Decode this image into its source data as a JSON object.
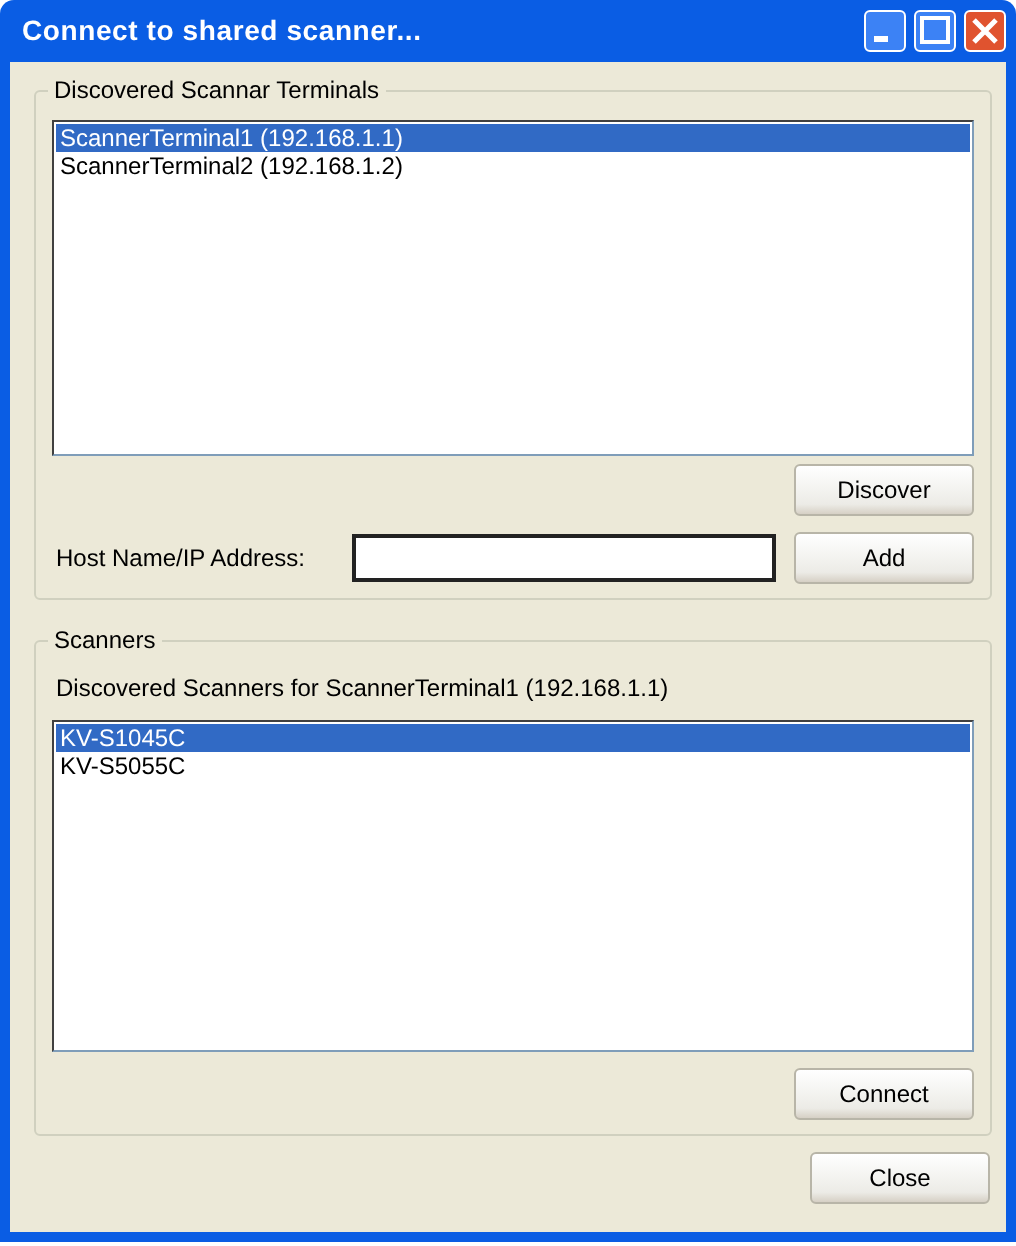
{
  "window": {
    "title": "Connect to shared scanner..."
  },
  "terminals_group": {
    "legend": "Discovered Scannar Terminals",
    "items": [
      {
        "label": "ScannerTerminal1 (192.168.1.1)",
        "selected": true
      },
      {
        "label": "ScannerTerminal2 (192.168.1.2)",
        "selected": false
      }
    ],
    "discover_button": "Discover",
    "host_label": "Host Name/IP Address:",
    "add_button": "Add"
  },
  "scanners_group": {
    "legend": "Scanners",
    "caption": "Discovered Scanners for ScannerTerminal1 (192.168.1.1)",
    "items": [
      {
        "label": "KV-S1045C",
        "selected": true
      },
      {
        "label": "KV-S5055C",
        "selected": false
      }
    ],
    "connect_button": "Connect"
  },
  "close_button": "Close"
}
